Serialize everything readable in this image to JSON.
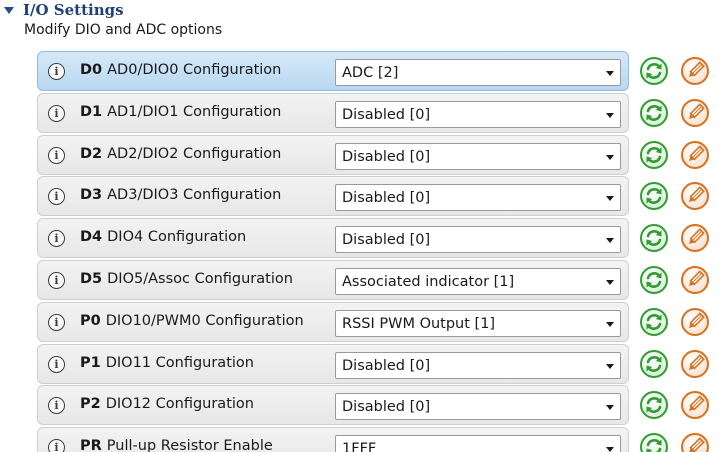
{
  "section": {
    "title": "I/O Settings",
    "description": "Modify DIO and ADC options"
  },
  "rows": [
    {
      "code": "D0",
      "label": "AD0/DIO0 Configuration",
      "value": "ADC [2]",
      "selected": true
    },
    {
      "code": "D1",
      "label": "AD1/DIO1 Configuration",
      "value": "Disabled [0]"
    },
    {
      "code": "D2",
      "label": "AD2/DIO2 Configuration",
      "value": "Disabled [0]"
    },
    {
      "code": "D3",
      "label": "AD3/DIO3 Configuration",
      "value": "Disabled [0]"
    },
    {
      "code": "D4",
      "label": "DIO4 Configuration",
      "value": "Disabled [0]"
    },
    {
      "code": "D5",
      "label": "DIO5/Assoc Configuration",
      "value": "Associated indicator [1]"
    },
    {
      "code": "P0",
      "label": "DIO10/PWM0 Configuration",
      "value": "RSSI PWM Output [1]"
    },
    {
      "code": "P1",
      "label": "DIO11 Configuration",
      "value": "Disabled [0]"
    },
    {
      "code": "P2",
      "label": "DIO12 Configuration",
      "value": "Disabled [0]"
    },
    {
      "code": "PR",
      "label": "Pull-up Resistor Enable",
      "value": "1FFF"
    }
  ],
  "icons": {
    "info": "info-icon",
    "refresh": "refresh-icon",
    "write": "pencil-icon",
    "dropdown": "chevron-down-icon",
    "collapse": "collapse-arrow-icon"
  },
  "colors": {
    "title": "#1f3f7a",
    "refresh_green": "#2e9e2e",
    "write_orange": "#d8701e",
    "selected_row": "#b9d8f1"
  }
}
